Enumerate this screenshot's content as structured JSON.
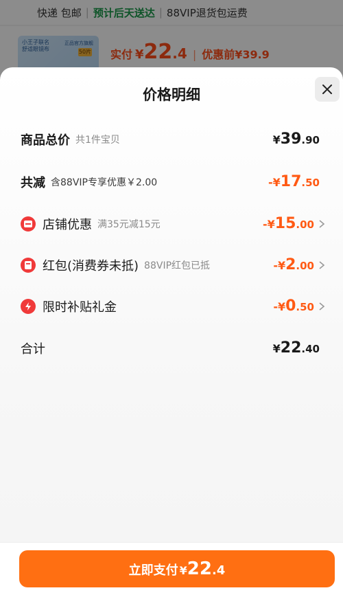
{
  "background": {
    "shipping": {
      "carrier": "快递 包邮",
      "eta": "预计后天送达",
      "service": "88VIP退货包运费"
    },
    "product": {
      "thumb_line1": "小王子联名",
      "thumb_line2": "舒适眼镜布",
      "thumb_side": "正品官方旗舰",
      "thumb_tag": "50片",
      "price_label": "实付",
      "price_yen": "¥",
      "price_int": "22",
      "price_dec": ".4",
      "price_sep": "|",
      "price_before": "优惠前¥39.9"
    }
  },
  "sheet": {
    "title": "价格明细",
    "rows": [
      {
        "label": "商品总价",
        "note": "共1件宝贝",
        "yen": "¥",
        "main": "39",
        "dec": ".90",
        "sign": ""
      },
      {
        "label": "共减",
        "note": "含88VIP专享优惠￥2.00",
        "yen": "¥",
        "main": "17",
        "dec": ".50",
        "sign": "-"
      },
      {
        "label": "店铺优惠",
        "note": "满35元减15元",
        "yen": "¥",
        "main": "15",
        "dec": ".00",
        "sign": "-"
      },
      {
        "label": "红包(消费券未抵)",
        "note": "88VIP红包已抵",
        "yen": "¥",
        "main": "2",
        "dec": ".00",
        "sign": "-"
      },
      {
        "label": "限时补贴礼金",
        "note": "",
        "yen": "¥",
        "main": "0",
        "dec": ".50",
        "sign": "-"
      },
      {
        "label": "合计",
        "note": "",
        "yen": "¥",
        "main": "22",
        "dec": ".40",
        "sign": ""
      }
    ]
  },
  "footer": {
    "pay_label": "立即支付",
    "pay_yen": "¥",
    "pay_int": "22",
    "pay_dec": ".4"
  },
  "colors": {
    "accent": "#ff6f12",
    "discount": "#ff5a14",
    "icon_red": "#f03a3a",
    "eta_green": "#1a9a4a"
  },
  "icons": [
    "close-icon",
    "shop-coupon-icon",
    "red-packet-icon",
    "lightning-icon",
    "chevron-right-icon"
  ]
}
